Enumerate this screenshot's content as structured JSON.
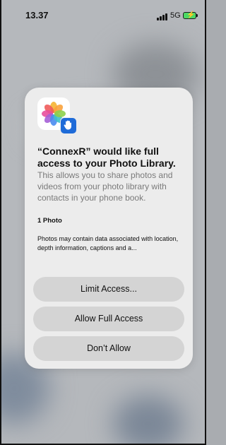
{
  "status_bar": {
    "time": "13.37",
    "network": "5G",
    "battery_color": "#4cd964"
  },
  "dialog": {
    "app_icon": "photos-app-icon",
    "badge_icon": "hand-raised-icon",
    "title": "“ConnexR” would like full access to your Photo Library.",
    "description": "This allows you to share photos and videos from your photo library with contacts in your phone book.",
    "photo_count": "1 Photo",
    "metadata_note": "Photos may contain data associated with location, depth information, captions and a...",
    "buttons": {
      "limit": "Limit Access...",
      "allow_full": "Allow Full Access",
      "deny": "Don’t Allow"
    }
  },
  "colors": {
    "dialog_bg": "#ececec",
    "button_bg": "#d4d4d4",
    "badge_blue": "#1f6bd8"
  }
}
